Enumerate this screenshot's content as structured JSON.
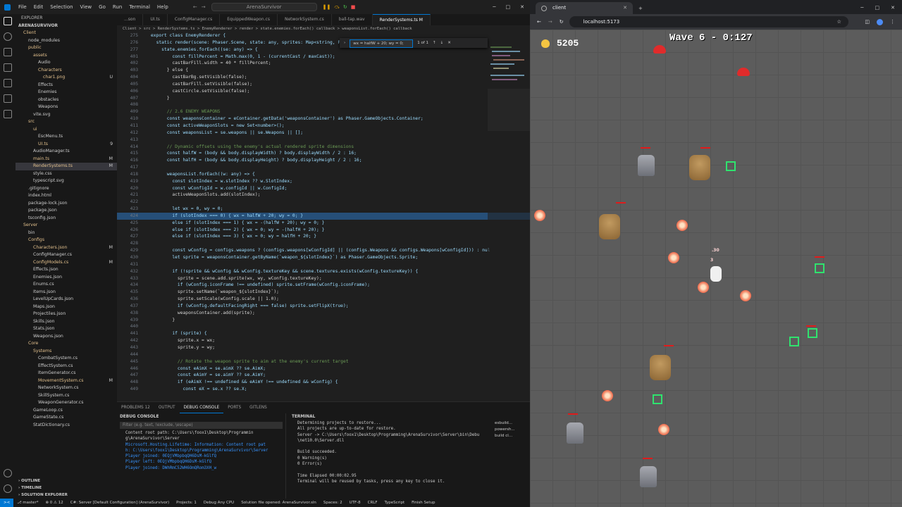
{
  "vscode": {
    "menu": [
      "File",
      "Edit",
      "Selection",
      "View",
      "Go",
      "Run",
      "Terminal",
      "Help"
    ],
    "search_title": "ArenaSurvivor",
    "explorer": {
      "header": "EXPLORER",
      "root": "ARENASURVIVOR",
      "items": [
        {
          "label": "Client",
          "depth": 1,
          "mod": true,
          "badge": ""
        },
        {
          "label": "node_modules",
          "depth": 2,
          "mod": false,
          "badge": ""
        },
        {
          "label": "public",
          "depth": 2,
          "mod": true,
          "badge": ""
        },
        {
          "label": "assets",
          "depth": 3,
          "mod": true,
          "badge": ""
        },
        {
          "label": "Audio",
          "depth": 4,
          "mod": false,
          "badge": ""
        },
        {
          "label": "Characters",
          "depth": 4,
          "mod": true,
          "badge": ""
        },
        {
          "label": "char1.png",
          "depth": 5,
          "mod": true,
          "badge": "U"
        },
        {
          "label": "Effects",
          "depth": 4,
          "mod": false,
          "badge": ""
        },
        {
          "label": "Enemies",
          "depth": 4,
          "mod": false,
          "badge": ""
        },
        {
          "label": "obstacles",
          "depth": 4,
          "mod": false,
          "badge": ""
        },
        {
          "label": "Weapons",
          "depth": 4,
          "mod": false,
          "badge": ""
        },
        {
          "label": "vite.svg",
          "depth": 3,
          "mod": false,
          "badge": ""
        },
        {
          "label": "src",
          "depth": 2,
          "mod": true,
          "badge": ""
        },
        {
          "label": "ui",
          "depth": 3,
          "mod": true,
          "badge": ""
        },
        {
          "label": "EscMenu.ts",
          "depth": 4,
          "mod": false,
          "badge": ""
        },
        {
          "label": "UI.ts",
          "depth": 4,
          "mod": true,
          "badge": "9"
        },
        {
          "label": "AudioManager.ts",
          "depth": 3,
          "mod": false,
          "badge": ""
        },
        {
          "label": "main.ts",
          "depth": 3,
          "mod": true,
          "badge": "M"
        },
        {
          "label": "RenderSystems.ts",
          "depth": 3,
          "mod": true,
          "badge": "M",
          "sel": true
        },
        {
          "label": "style.css",
          "depth": 3,
          "mod": false,
          "badge": ""
        },
        {
          "label": "typescript.svg",
          "depth": 3,
          "mod": false,
          "badge": ""
        },
        {
          "label": ".gitignore",
          "depth": 2,
          "mod": false,
          "badge": ""
        },
        {
          "label": "index.html",
          "depth": 2,
          "mod": false,
          "badge": ""
        },
        {
          "label": "package-lock.json",
          "depth": 2,
          "mod": false,
          "badge": ""
        },
        {
          "label": "package.json",
          "depth": 2,
          "mod": false,
          "badge": ""
        },
        {
          "label": "tsconfig.json",
          "depth": 2,
          "mod": false,
          "badge": ""
        },
        {
          "label": "Server",
          "depth": 1,
          "mod": true,
          "badge": ""
        },
        {
          "label": "bin",
          "depth": 2,
          "mod": false,
          "badge": ""
        },
        {
          "label": "Configs",
          "depth": 2,
          "mod": true,
          "badge": ""
        },
        {
          "label": "Characters.json",
          "depth": 3,
          "mod": true,
          "badge": "M"
        },
        {
          "label": "ConfigManager.cs",
          "depth": 3,
          "mod": false,
          "badge": ""
        },
        {
          "label": "ConfigModels.cs",
          "depth": 3,
          "mod": true,
          "badge": "M"
        },
        {
          "label": "Effects.json",
          "depth": 3,
          "mod": false,
          "badge": ""
        },
        {
          "label": "Enemies.json",
          "depth": 3,
          "mod": false,
          "badge": ""
        },
        {
          "label": "Enums.cs",
          "depth": 3,
          "mod": false,
          "badge": ""
        },
        {
          "label": "Items.json",
          "depth": 3,
          "mod": false,
          "badge": ""
        },
        {
          "label": "LevelUpCards.json",
          "depth": 3,
          "mod": false,
          "badge": ""
        },
        {
          "label": "Maps.json",
          "depth": 3,
          "mod": false,
          "badge": ""
        },
        {
          "label": "Projectiles.json",
          "depth": 3,
          "mod": false,
          "badge": ""
        },
        {
          "label": "Skills.json",
          "depth": 3,
          "mod": false,
          "badge": ""
        },
        {
          "label": "Stats.json",
          "depth": 3,
          "mod": false,
          "badge": ""
        },
        {
          "label": "Weapons.json",
          "depth": 3,
          "mod": false,
          "badge": ""
        },
        {
          "label": "Core",
          "depth": 2,
          "mod": true,
          "badge": ""
        },
        {
          "label": "Systems",
          "depth": 3,
          "mod": true,
          "badge": ""
        },
        {
          "label": "CombatSystem.cs",
          "depth": 4,
          "mod": false,
          "badge": ""
        },
        {
          "label": "EffectSystem.cs",
          "depth": 4,
          "mod": false,
          "badge": ""
        },
        {
          "label": "ItemGenerator.cs",
          "depth": 4,
          "mod": false,
          "badge": ""
        },
        {
          "label": "MovementSystem.cs",
          "depth": 4,
          "mod": true,
          "badge": "M"
        },
        {
          "label": "NetworkSystem.cs",
          "depth": 4,
          "mod": false,
          "badge": ""
        },
        {
          "label": "SkillSystem.cs",
          "depth": 4,
          "mod": false,
          "badge": ""
        },
        {
          "label": "WeaponGenerator.cs",
          "depth": 4,
          "mod": false,
          "badge": ""
        },
        {
          "label": "GameLoop.cs",
          "depth": 3,
          "mod": false,
          "badge": ""
        },
        {
          "label": "GameState.cs",
          "depth": 3,
          "mod": false,
          "badge": ""
        },
        {
          "label": "StatDictionary.cs",
          "depth": 3,
          "mod": false,
          "badge": ""
        }
      ],
      "footer": [
        "OUTLINE",
        "TIMELINE",
        "SOLUTION EXPLORER"
      ]
    },
    "tabs": [
      "...son",
      "UI.ts",
      "ConfigManager.cs",
      "EquippedWeapon.cs",
      "NetworkSystem.cs",
      "ball-tap.wav",
      "RenderSystems.ts M"
    ],
    "active_tab": "RenderSystems.ts M",
    "breadcrumb": "Client > src > RenderSystems.ts > EnemyRenderer > render > state.enemies.forEach() callback > weaponsList.forEach() callback",
    "find": {
      "value": "wx = halfW + 20; wy = 0;",
      "result": "1 of 1"
    },
    "code": [
      [
        "275",
        "export class EnemyRenderer {"
      ],
      [
        "276",
        "  static render(scene: Phaser.Scene, state: any, sprites: Map<string, P"
      ],
      [
        "277",
        "    state.enemies.forEach((se: any) => {"
      ],
      [
        "401",
        "        const fillPercent = Math.max(0, 1 - (currentCast / maxCast));"
      ],
      [
        "402",
        "        castBarFill.width = 40 * fillPercent;"
      ],
      [
        "403",
        "      } else {"
      ],
      [
        "404",
        "        castBarBg.setVisible(false);"
      ],
      [
        "405",
        "        castBarFill.setVisible(false);"
      ],
      [
        "406",
        "        castCircle.setVisible(false);"
      ],
      [
        "407",
        "      }"
      ],
      [
        "408",
        ""
      ],
      [
        "409",
        "      // 2.6 ENEMY WEAPONS"
      ],
      [
        "410",
        "      const weaponsContainer = eContainer.getData('weaponsContainer') as Phaser.GameObjects.Container;"
      ],
      [
        "411",
        "      const activeWeaponSlots = new Set<number>();"
      ],
      [
        "412",
        "      const weaponsList = se.weapons || se.Weapons || [];"
      ],
      [
        "413",
        ""
      ],
      [
        "414",
        "      // Dynamic offsets using the enemy's actual rendered sprite dimensions"
      ],
      [
        "415",
        "      const halfW = (body && body.displayWidth) ? body.displayWidth / 2 : 16;"
      ],
      [
        "416",
        "      const halfH = (body && body.displayHeight) ? body.displayHeight / 2 : 16;"
      ],
      [
        "417",
        ""
      ],
      [
        "418",
        "      weaponsList.forEach((w: any) => {"
      ],
      [
        "419",
        "        const slotIndex = w.slotIndex ?? w.SlotIndex;"
      ],
      [
        "420",
        "        const wConfigId = w.configId || w.ConfigId;"
      ],
      [
        "421",
        "        activeWeaponSlots.add(slotIndex);"
      ],
      [
        "422",
        ""
      ],
      [
        "423",
        "        let wx = 0, wy = 0;"
      ],
      [
        "424",
        "        if (slotIndex === 0) { wx = halfW + 20; wy = 0; }"
      ],
      [
        "425",
        "        else if (slotIndex === 1) { wx = -(halfW + 20); wy = 0; }"
      ],
      [
        "426",
        "        else if (slotIndex === 2) { wx = 0; wy = -(halfH + 20); }"
      ],
      [
        "427",
        "        else if (slotIndex === 3) { wx = 0; wy = halfH + 20; }"
      ],
      [
        "428",
        ""
      ],
      [
        "429",
        "        const wConfig = configs.weapons ? (configs.weapons[wConfigId] || (configs.Weapons && configs.Weapons[wConfigId])) : nul"
      ],
      [
        "430",
        "        let sprite = weaponsContainer.getByName(`weapon_${slotIndex}`) as Phaser.GameObjects.Sprite;"
      ],
      [
        "431",
        ""
      ],
      [
        "432",
        "        if (!sprite && wConfig && wConfig.textureKey && scene.textures.exists(wConfig.textureKey)) {"
      ],
      [
        "433",
        "          sprite = scene.add.sprite(wx, wy, wConfig.textureKey);"
      ],
      [
        "434",
        "          if (wConfig.iconFrame !== undefined) sprite.setFrame(wConfig.iconFrame);"
      ],
      [
        "435",
        "          sprite.setName(`weapon_${slotIndex}`);"
      ],
      [
        "436",
        "          sprite.setScale(wConfig.scale || 1.0);"
      ],
      [
        "437",
        "          if (wConfig.defaultFacingRight === false) sprite.setFlipX(true);"
      ],
      [
        "438",
        "          weaponsContainer.add(sprite);"
      ],
      [
        "439",
        "        }"
      ],
      [
        "440",
        ""
      ],
      [
        "441",
        "        if (sprite) {"
      ],
      [
        "442",
        "          sprite.x = wx;"
      ],
      [
        "443",
        "          sprite.y = wy;"
      ],
      [
        "444",
        ""
      ],
      [
        "445",
        "          // Rotate the weapon sprite to aim at the enemy's current target"
      ],
      [
        "446",
        "          const eAimX = se.aimX ?? se.AimX;"
      ],
      [
        "447",
        "          const eAimY = se.aimY ?? se.AimY;"
      ],
      [
        "448",
        "          if (eAimX !== undefined && eAimY !== undefined && wConfig) {"
      ],
      [
        "449",
        "            const eX = se.x ?? se.X;"
      ]
    ],
    "panel_tabs": [
      "PROBLEMS 12",
      "OUTPUT",
      "DEBUG CONSOLE",
      "PORTS",
      "GITLENS"
    ],
    "active_panel_tab": "DEBUG CONSOLE",
    "debug_title": "DEBUG CONSOLE",
    "debug_filter": "Filter (e.g. text, !exclude, \\escape)",
    "debug_lines": [
      {
        "t": "      Content root path: C:\\Users\\foox1\\Desktop\\Programmin",
        "c": ""
      },
      {
        "t": "g\\ArenaSurvivor\\Server",
        "c": ""
      },
      {
        "t": "Microsoft.Hosting.Lifetime: Information: Content root pat",
        "c": "blue"
      },
      {
        "t": "h: C:\\Users\\foox1\\Desktop\\Programming\\ArenaSurvivor\\Server",
        "c": "blue"
      },
      {
        "t": "Player joined: 0EQjVMbpbqQH6DsM-kGlfQ",
        "c": "blue"
      },
      {
        "t": "Player left: 0EQjVMbpbqQH6DsM-kGlfQ",
        "c": "blue"
      },
      {
        "t": "Player joined: DWhRmC52WH6OmQRom3XH_w",
        "c": "blue"
      }
    ],
    "terminal_title": "TERMINAL",
    "terminal_lines": [
      "Determining projects to restore...",
      "All projects are up-to-date for restore.",
      "Server -> C:\\Users\\foox1\\Desktop\\Programming\\ArenaSurvivor\\Server\\bin\\Debug",
      "\\net10.0\\Server.dll",
      "",
      "Build succeeded.",
      "    0 Warning(s)",
      "    0 Error(s)",
      "",
      "Time Elapsed 00:00:02.95",
      "Terminal will be reused by tasks, press any key to close it."
    ],
    "terminal_sessions": [
      "esbuild...",
      "powersh...",
      "build cl..."
    ],
    "status": {
      "remote": "><",
      "branch": "master*",
      "errors": "0",
      "warnings": "12",
      "items": [
        "C#: Server [Default Configuration] (ArenaSurvivor)",
        "Projects: 1",
        "Debug Any CPU",
        "Solution file opened: ArenaSurvivor.sln",
        "Spaces: 2",
        "UTF-8",
        "CRLF",
        "TypeScript",
        "Finish Setup"
      ]
    }
  },
  "browser": {
    "tab_title": "client",
    "url": "localhost:5173"
  },
  "game": {
    "coins": "5205",
    "wave": "Wave 6 - 0:127",
    "coin_color": "#f5c542",
    "grid_color": "#5c5c5c",
    "selection_color": "#2fe36e",
    "damage_text": [
      "3",
      ".30"
    ]
  }
}
